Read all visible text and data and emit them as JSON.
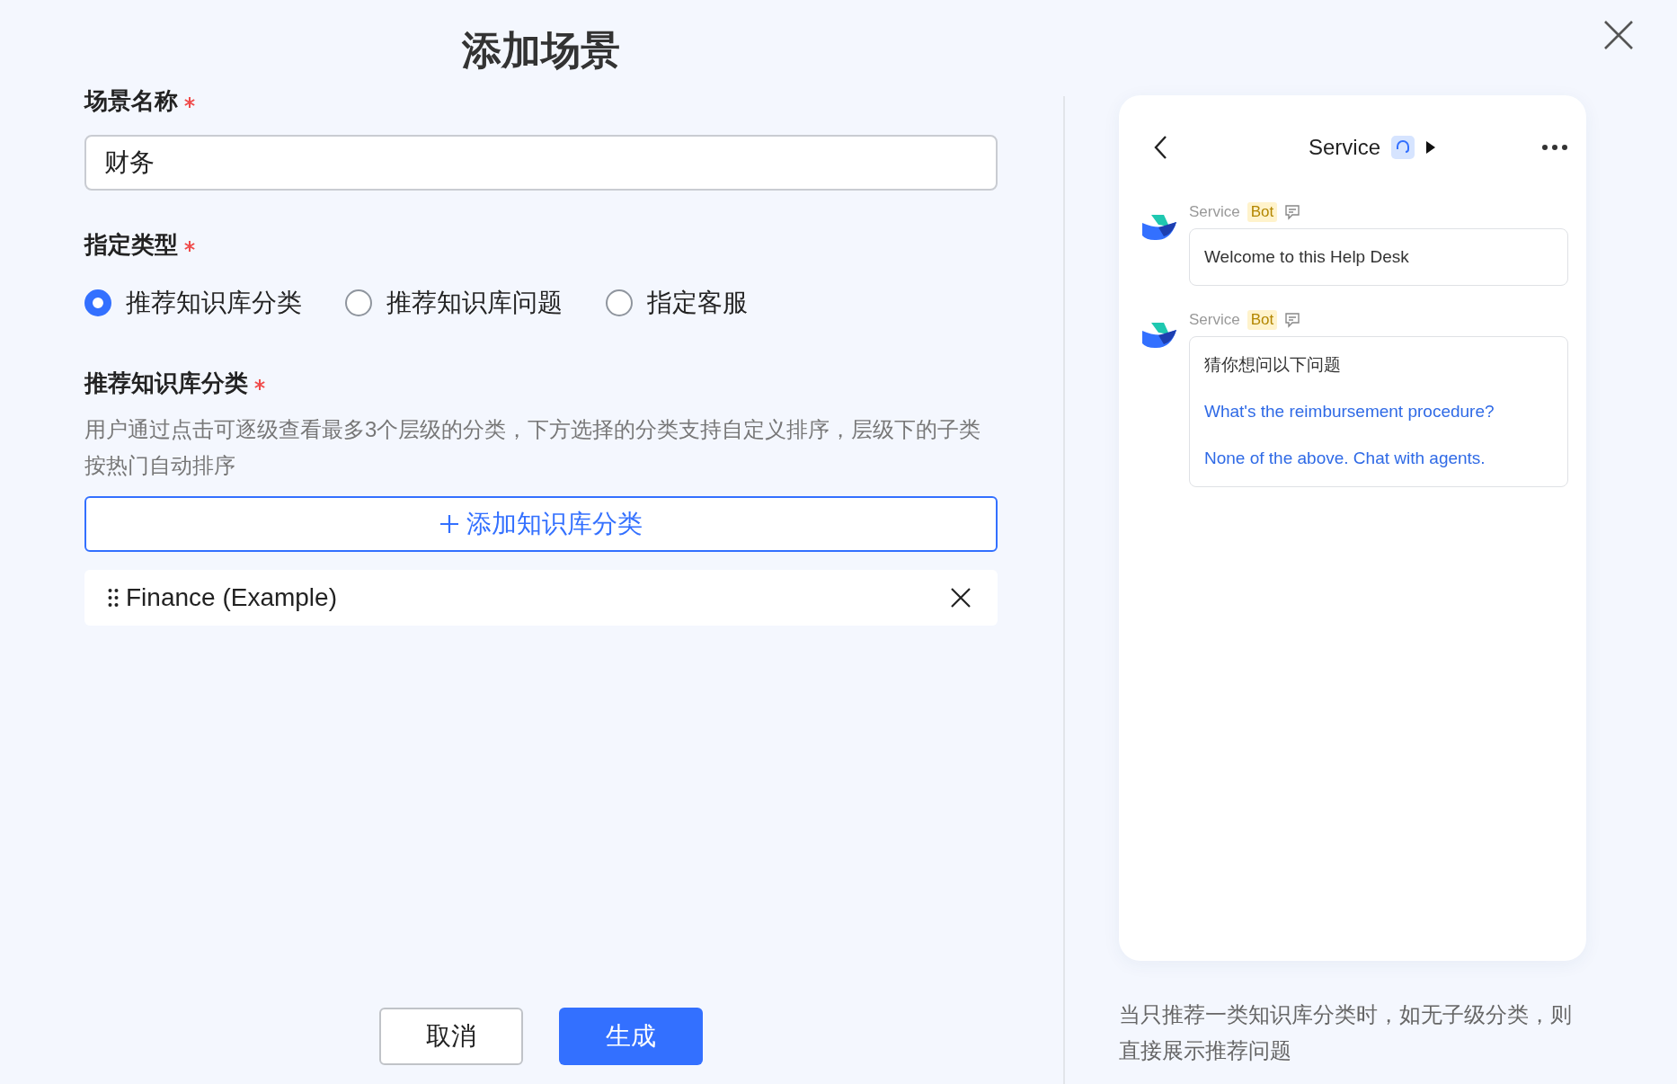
{
  "title": "添加场景",
  "form": {
    "name_field": {
      "label": "场景名称",
      "required": true,
      "value": "财务"
    },
    "type_field": {
      "label": "指定类型",
      "required": true,
      "options": [
        {
          "label": "推荐知识库分类",
          "selected": true
        },
        {
          "label": "推荐知识库问题",
          "selected": false
        },
        {
          "label": "指定客服",
          "selected": false
        }
      ]
    },
    "category_field": {
      "label": "推荐知识库分类",
      "required": true,
      "description": "用户通过点击可逐级查看最多3个层级的分类，下方选择的分类支持自定义排序，层级下的子类按热门自动排序",
      "add_button": "添加知识库分类",
      "items": [
        {
          "label": "Finance (Example)"
        }
      ]
    }
  },
  "actions": [
    {
      "label": "取消",
      "kind": "secondary"
    },
    {
      "label": "生成",
      "kind": "primary"
    }
  ],
  "preview": {
    "header": {
      "title": "Service"
    },
    "messages": [
      {
        "sender": "Service",
        "badge": "Bot",
        "kind": "text",
        "text": "Welcome to this Help Desk"
      },
      {
        "sender": "Service",
        "badge": "Bot",
        "kind": "suggestions",
        "text": "猜你想问以下问题",
        "links": [
          "What's the reimbursement procedure?",
          "None of the above. Chat with agents."
        ]
      }
    ],
    "caption": "当只推荐一类知识库分类时，如无子级分类，则直接展示推荐问题"
  }
}
